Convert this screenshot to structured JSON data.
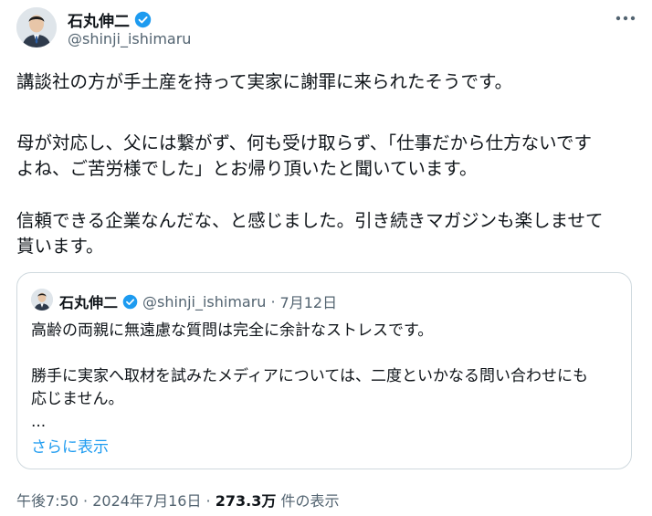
{
  "author": {
    "display_name": "石丸伸二",
    "handle": "@shinji_ishimaru",
    "avatar_icon": "avatar-photo",
    "verified_icon": "verified-badge-icon",
    "verified_color": "#1d9bf0"
  },
  "tweet": {
    "paragraphs": [
      "講談社の方が手土産を持って実家に謝罪に来られたそうです。",
      "母が対応し、父には繋がず、何も受け取らず、「仕事だから仕方ないです",
      "よね、ご苦労様でした」とお帰り頂いたと聞いています。",
      "信頼できる企業なんだな、と感じました。引き続きマガジンも楽しませて",
      "貰います。"
    ]
  },
  "quoted": {
    "display_name": "石丸伸二",
    "handle": "@shinji_ishimaru",
    "separator": "·",
    "date": "7月12日",
    "lines": [
      "高齢の両親に無遠慮な質問は完全に余計なストレスです。",
      "勝手に実家へ取材を試みたメディアについては、二度といかなる問い合わせにも",
      "応じません。",
      "..."
    ],
    "show_more": "さらに表示"
  },
  "meta": {
    "time": "午後7:50",
    "sep1": " · ",
    "date": "2024年7月16日",
    "sep2": " · ",
    "views_count": "273.3万",
    "views_label": " 件の表示"
  },
  "colors": {
    "text": "#0f1419",
    "secondary": "#536471",
    "link": "#1d9bf0",
    "border": "#cfd9de"
  }
}
